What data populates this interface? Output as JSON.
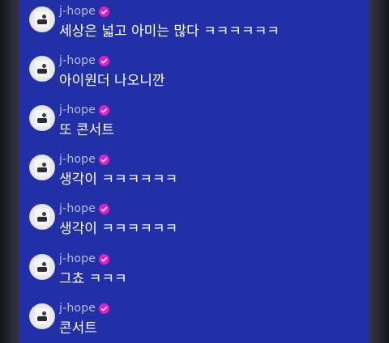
{
  "chat": {
    "badge_color": "#e21fc6",
    "messages": [
      {
        "author": "j-hope",
        "text": "세상은 넓고 아미는 많다 ㅋㅋㅋㅋㅋㅋ"
      },
      {
        "author": "j-hope",
        "text": "아이원더 나오니깐"
      },
      {
        "author": "j-hope",
        "text": "또 콘서트"
      },
      {
        "author": "j-hope",
        "text": "생각이 ㅋㅋㅋㅋㅋㅋ"
      },
      {
        "author": "j-hope",
        "text": "생각이 ㅋㅋㅋㅋㅋㅋ"
      },
      {
        "author": "j-hope",
        "text": "그쵸 ㅋㅋㅋ"
      },
      {
        "author": "j-hope",
        "text": "콘서트"
      }
    ]
  }
}
